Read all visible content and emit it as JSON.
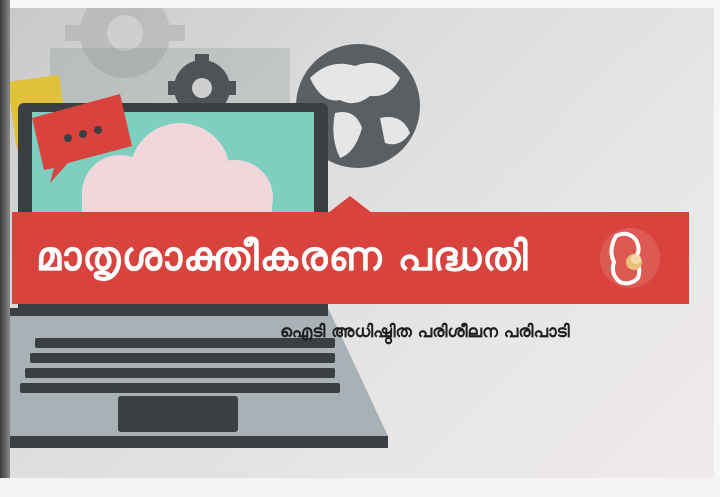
{
  "poster": {
    "title": "മാതൃശാക്തീകരണ പദ്ധതി",
    "subtitle": "ഐടി അധിഷ്ഠിത പരിശീലന പരിപാടി"
  },
  "icons": [
    "gear-icon",
    "globe-icon",
    "chat-bubble-icon",
    "cloud-icon",
    "laptop-icon",
    "mother-child-logo"
  ],
  "colors": {
    "banner": "#d9433d",
    "title_text": "#ffffff",
    "subtitle_text": "#1f1f1f",
    "screen": "#7fcfc0",
    "laptop_body": "#a8b1b6",
    "laptop_dark": "#3b3f43"
  }
}
